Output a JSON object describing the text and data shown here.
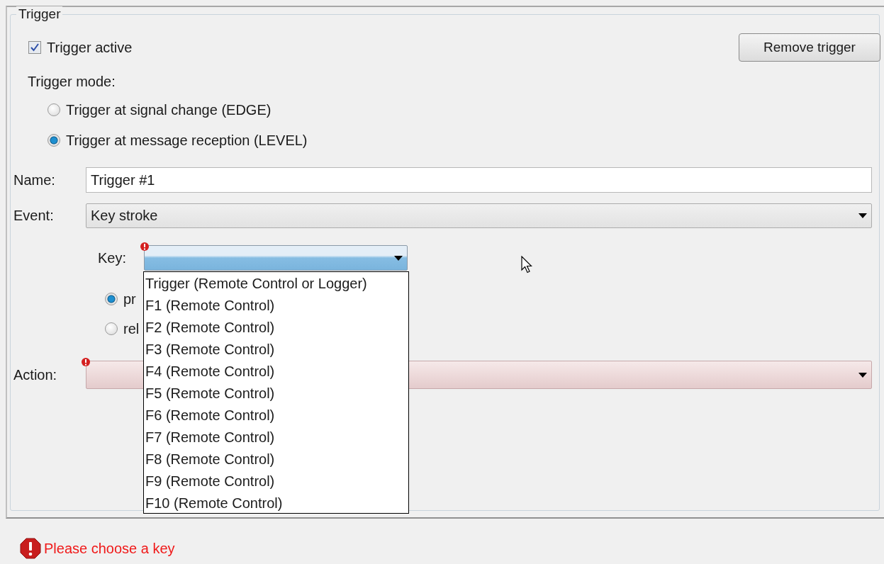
{
  "group": {
    "title": "Trigger"
  },
  "trigger_active": {
    "label": "Trigger active",
    "checked": true
  },
  "remove_button": {
    "label": "Remove trigger"
  },
  "mode": {
    "label": "Trigger mode:",
    "options": [
      {
        "label": "Trigger at signal change (EDGE)",
        "selected": false
      },
      {
        "label": "Trigger at message reception (LEVEL)",
        "selected": true
      }
    ]
  },
  "name": {
    "label": "Name:",
    "value": "Trigger #1"
  },
  "event": {
    "label": "Event:",
    "value": "Key stroke"
  },
  "key": {
    "label": "Key:",
    "error": true,
    "expanded": true,
    "options": [
      {
        "label": "Trigger (Remote Control or Logger)"
      },
      {
        "label": "F1 (Remote Control)"
      },
      {
        "label": "F2 (Remote Control)"
      },
      {
        "label": "F3 (Remote Control)"
      },
      {
        "label": "F4 (Remote Control)"
      },
      {
        "label": "F5 (Remote Control)"
      },
      {
        "label": "F6 (Remote Control)"
      },
      {
        "label": "F7 (Remote Control)"
      },
      {
        "label": "F8 (Remote Control)"
      },
      {
        "label": "F9 (Remote Control)"
      },
      {
        "label": "F10 (Remote Control)"
      }
    ]
  },
  "key_state": {
    "options": [
      {
        "label": "pr",
        "selected": true
      },
      {
        "label": "rel",
        "selected": false
      }
    ]
  },
  "action": {
    "label": "Action:",
    "error": true
  },
  "status": {
    "message": "Please choose a key"
  }
}
